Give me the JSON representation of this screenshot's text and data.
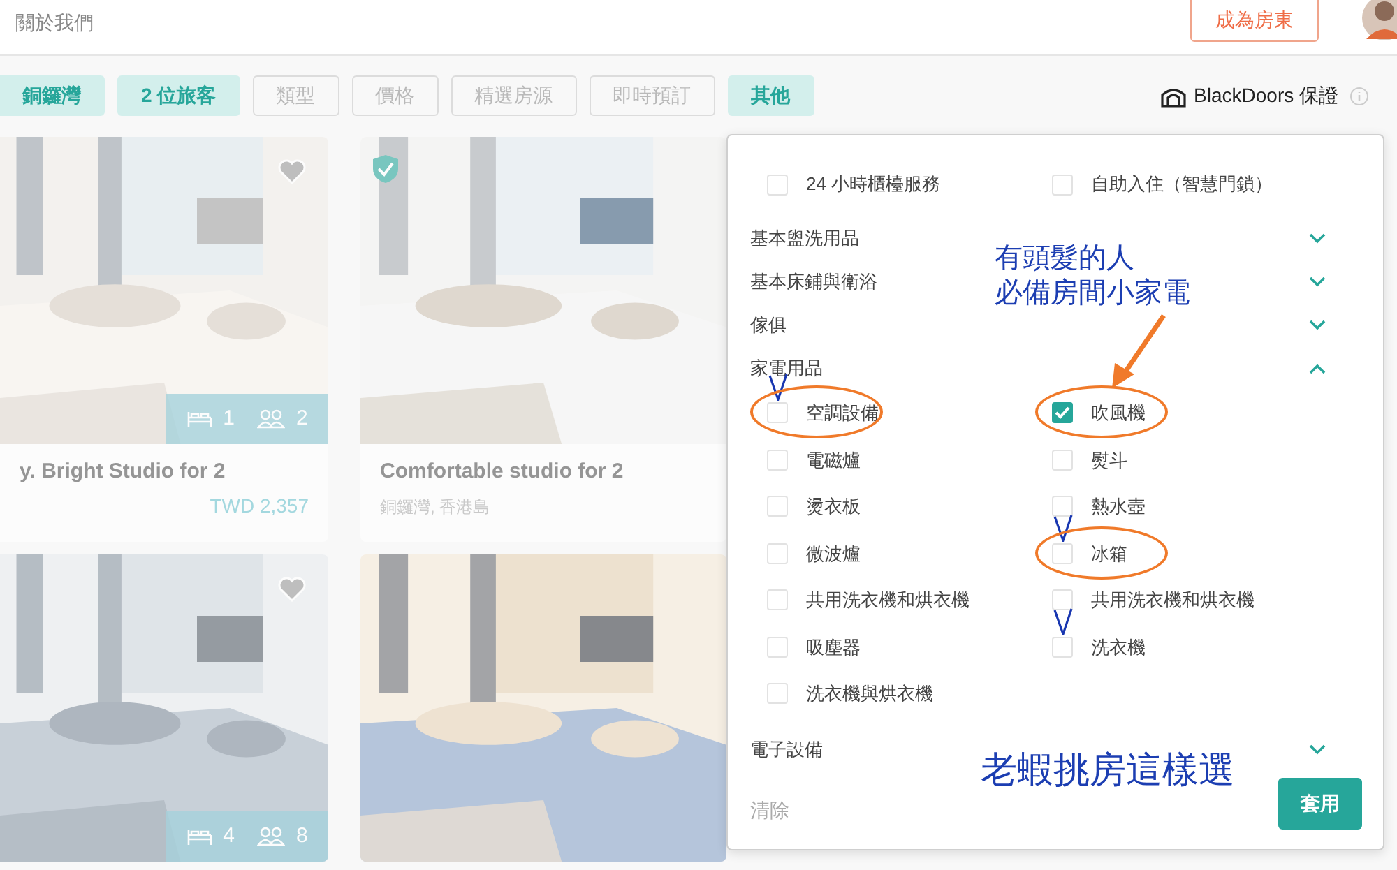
{
  "header": {
    "about_link": "關於我們",
    "host_button": "成為房東"
  },
  "filters": [
    {
      "label": "銅鑼灣",
      "active": true
    },
    {
      "label": "2 位旅客",
      "active": true
    },
    {
      "label": "類型",
      "active": false
    },
    {
      "label": "價格",
      "active": false
    },
    {
      "label": "精選房源",
      "active": false
    },
    {
      "label": "即時預訂",
      "active": false
    },
    {
      "label": "其他",
      "active": true
    }
  ],
  "guarantee": {
    "label": "BlackDoors 保證"
  },
  "listings": [
    {
      "kind": "picture",
      "heart": true,
      "beds": "1",
      "guests": "2",
      "title": "y. Bright Studio for 2",
      "price": "TWD 2,357"
    },
    {
      "kind": "picture",
      "verified": true,
      "title": "Comfortable studio for 2",
      "location": "銅鑼灣, 香港島"
    },
    {
      "kind": "picture",
      "heart": true,
      "beds": "4",
      "guests": "8"
    },
    {
      "kind": "picture"
    }
  ],
  "filter_panel": {
    "top_options": [
      {
        "label": "24 小時櫃檯服務",
        "checked": false
      },
      {
        "label": "自助入住（智慧門鎖）",
        "checked": false
      }
    ],
    "sections": [
      {
        "label": "基本盥洗用品",
        "expanded": false
      },
      {
        "label": "基本床鋪與衛浴",
        "expanded": false
      },
      {
        "label": "傢俱",
        "expanded": false
      },
      {
        "label": "家電用品",
        "expanded": true,
        "options": [
          {
            "label": "空調設備",
            "checked": false,
            "hand_tick": true,
            "circled": true
          },
          {
            "label": "吹風機",
            "checked": true,
            "hand_tick": false,
            "circled": true
          },
          {
            "label": "電磁爐",
            "checked": false,
            "hand_tick": false,
            "circled": false
          },
          {
            "label": "熨斗",
            "checked": false,
            "hand_tick": false,
            "circled": false
          },
          {
            "label": "燙衣板",
            "checked": false,
            "hand_tick": false,
            "circled": false
          },
          {
            "label": "熱水壺",
            "checked": false,
            "hand_tick": false,
            "circled": false
          },
          {
            "label": "微波爐",
            "checked": false,
            "hand_tick": false,
            "circled": false
          },
          {
            "label": "冰箱",
            "checked": false,
            "hand_tick": true,
            "circled": true
          },
          {
            "label": "共用洗衣機和烘衣機",
            "checked": false,
            "hand_tick": false,
            "circled": false
          },
          {
            "label": "共用洗衣機和烘衣機",
            "checked": false,
            "hand_tick": false,
            "circled": false
          },
          {
            "label": "吸塵器",
            "checked": false,
            "hand_tick": false,
            "circled": false
          },
          {
            "label": "洗衣機",
            "checked": false,
            "hand_tick": true,
            "circled": false
          },
          {
            "label": "洗衣機與烘衣機",
            "checked": false,
            "hand_tick": false,
            "circled": false
          }
        ]
      },
      {
        "label": "電子設備",
        "expanded": false
      }
    ],
    "clear_button": "清除",
    "apply_button": "套用"
  },
  "annotations": {
    "note_lines": [
      "有頭髮的人",
      "必備房間小家電"
    ],
    "caption": "老蝦挑房這樣選"
  }
}
